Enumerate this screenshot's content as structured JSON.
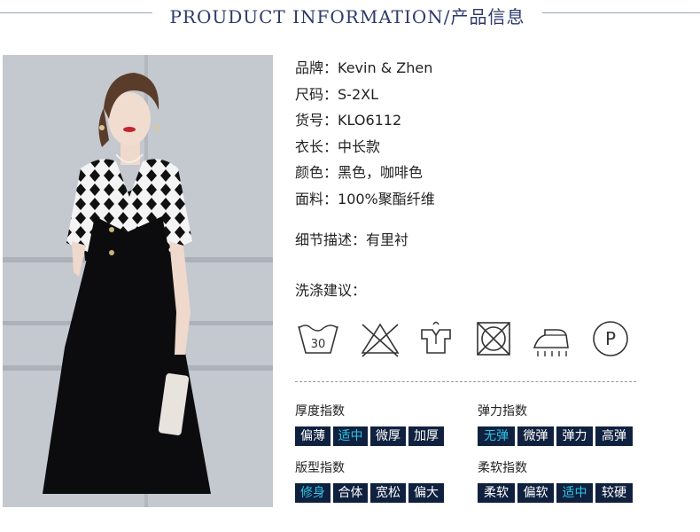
{
  "header": {
    "title": "PROUDUCT INFORMATION/产品信息"
  },
  "specs": [
    {
      "key": "品牌：",
      "value": "Kevin & Zhen"
    },
    {
      "key": "尺码：",
      "value": "S-2XL"
    },
    {
      "key": "货号：",
      "value": "KLO6112"
    },
    {
      "key": "衣长：",
      "value": "中长款"
    },
    {
      "key": "颜色：",
      "value": "黑色，咖啡色"
    },
    {
      "key": "面料：",
      "value": "100%聚酯纤维"
    }
  ],
  "detail": {
    "key": "细节描述：",
    "value": "有里衬"
  },
  "wash": {
    "title": "洗涤建议：",
    "icons": [
      {
        "name": "wash-30-icon",
        "text": "30"
      },
      {
        "name": "no-bleach-icon"
      },
      {
        "name": "hang-dry-icon"
      },
      {
        "name": "no-tumble-dry-icon"
      },
      {
        "name": "iron-icon"
      },
      {
        "name": "professional-dry-clean-icon",
        "text": "P"
      }
    ]
  },
  "indices": {
    "thickness": {
      "label": "厚度指数",
      "options": [
        "偏薄",
        "适中",
        "微厚",
        "加厚"
      ],
      "selected": 1
    },
    "elasticity": {
      "label": "弹力指数",
      "options": [
        "无弹",
        "微弹",
        "弹力",
        "高弹"
      ],
      "selected": 0
    },
    "fit": {
      "label": "版型指数",
      "options": [
        "修身",
        "合体",
        "宽松",
        "偏大"
      ],
      "selected": 0
    },
    "softness": {
      "label": "柔软指数",
      "options": [
        "柔软",
        "偏软",
        "适中",
        "较硬"
      ],
      "selected": 2
    }
  },
  "colors": {
    "title": "#2e3a6a",
    "bar": "#10213f",
    "selected": "#2ec4e6",
    "unselected": "#ffffff"
  }
}
